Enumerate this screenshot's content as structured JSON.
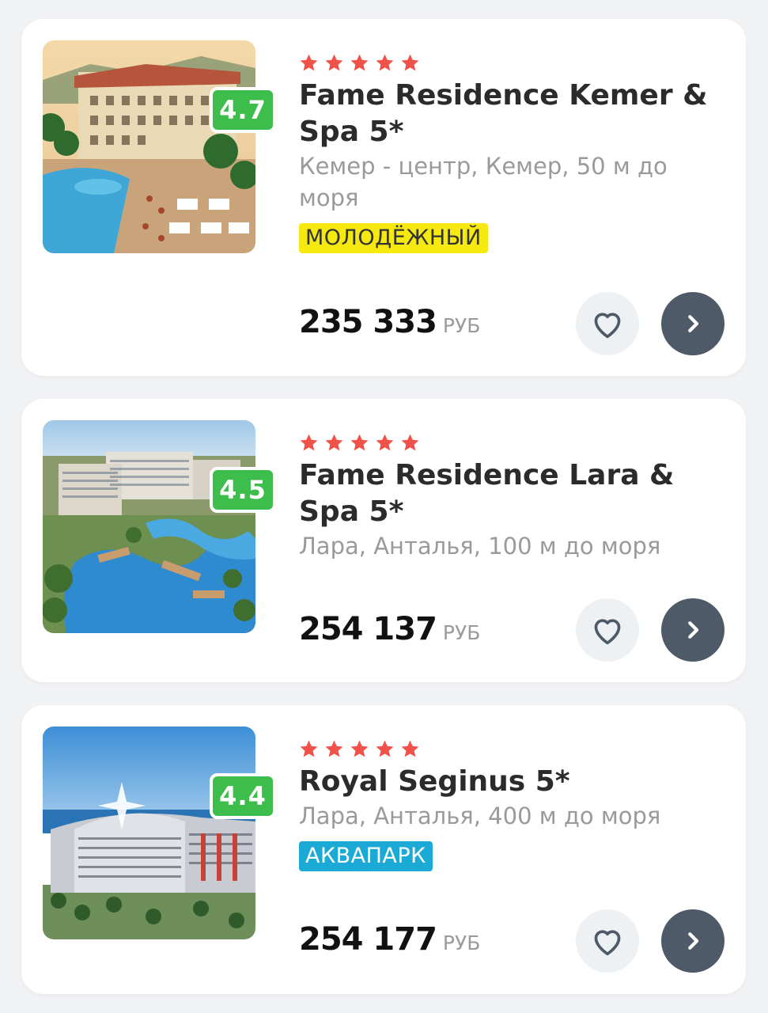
{
  "colors": {
    "rating_badge": "#3dbd4b",
    "star": "#f0524a",
    "tag_youth": "#f6e90f",
    "tag_waterpark": "#1ba9d6",
    "next_button": "#4e5a67"
  },
  "hotels": [
    {
      "rating": "4.7",
      "stars": 5,
      "name": "Fame Residence Kemer & Spa 5*",
      "location": "Кемер - центр, Кемер, 50 м до моря",
      "tag": "МОЛОДЁЖНЫЙ",
      "price": "235 333",
      "currency": "РУБ",
      "favorite_icon": "heart-icon",
      "next_icon": "chevron-right-icon"
    },
    {
      "rating": "4.5",
      "stars": 5,
      "name": "Fame Residence Lara & Spa 5*",
      "location": "Лара, Анталья, 100 м до моря",
      "price": "254 137",
      "currency": "РУБ",
      "favorite_icon": "heart-icon",
      "next_icon": "chevron-right-icon"
    },
    {
      "rating": "4.4",
      "stars": 5,
      "name": "Royal Seginus 5*",
      "location": "Лара, Анталья, 400 м до моря",
      "tag": "АКВАПАРК",
      "price": "254 177",
      "currency": "РУБ",
      "favorite_icon": "heart-icon",
      "next_icon": "chevron-right-icon"
    }
  ]
}
